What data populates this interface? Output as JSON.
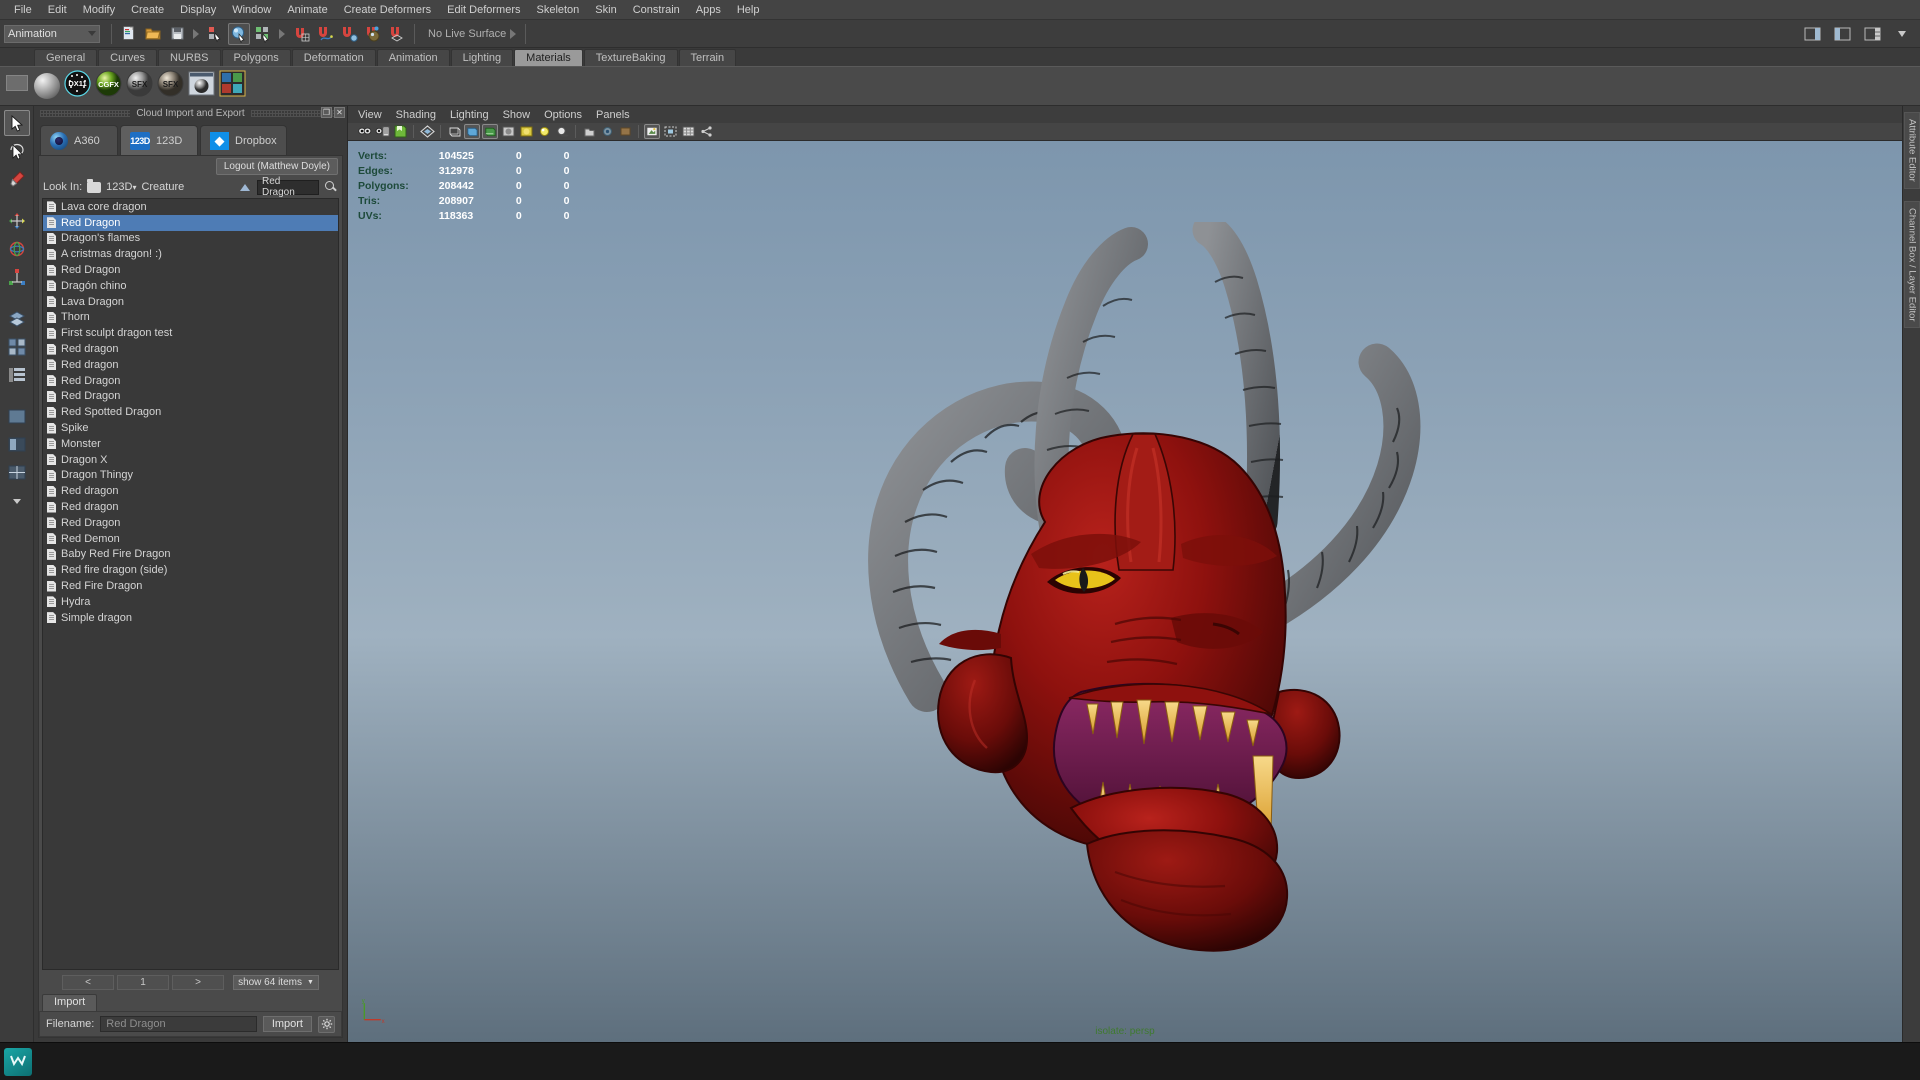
{
  "menubar": {
    "items": [
      "File",
      "Edit",
      "Modify",
      "Create",
      "Display",
      "Window",
      "Animate",
      "Create Deformers",
      "Edit Deformers",
      "Skeleton",
      "Skin",
      "Constrain",
      "Apps",
      "Help"
    ]
  },
  "toolbar": {
    "menuset_value": "Animation",
    "live_surface_label": "No Live Surface",
    "icons": [
      "new-scene-icon",
      "open-scene-icon",
      "save-scene-icon",
      "undo-icon",
      "redo-icon",
      "select-by-object-icon",
      "select-by-component-icon",
      "snap-to-grid-icon",
      "snap-to-curve-icon",
      "snap-to-point-icon",
      "snap-to-projected-center-icon",
      "snap-to-view-plane-icon"
    ]
  },
  "shelf": {
    "tabs": [
      "General",
      "Curves",
      "NURBS",
      "Polygons",
      "Deformation",
      "Animation",
      "Lighting",
      "Materials",
      "TextureBaking",
      "Terrain"
    ],
    "selected_tab": "Materials",
    "icons": [
      "material-sphere-icon",
      "dx11-shader-icon",
      "cgfx-shader-icon",
      "sfx-shader-icon",
      "sfx-alt-shader-icon",
      "render-preview-icon",
      "hypershade-grid-icon"
    ]
  },
  "tools": {
    "items": [
      "select-tool-icon",
      "lasso-select-icon",
      "paint-select-icon",
      "move-tool-icon",
      "rotate-tool-icon",
      "scale-tool-icon",
      "soft-mod-icon",
      "show-manipulator-icon",
      "last-tool-icon",
      "layout-single-icon",
      "layout-four-icon",
      "layout-persp-outliner-icon",
      "layout-hypershade-icon",
      "layout-dropdown-icon"
    ]
  },
  "cloud_panel": {
    "title": "Cloud Import and Export",
    "close_label": "✕",
    "restore_label": "❐",
    "tabs": [
      {
        "label": "A360",
        "icon": "a360-icon",
        "selected": false
      },
      {
        "label": "123D",
        "icon": "123d-icon",
        "selected": true
      },
      {
        "label": "Dropbox",
        "icon": "dropbox-icon",
        "selected": false
      }
    ],
    "logout_label": "Logout (Matthew Doyle)",
    "lookin_label": "Look In:",
    "breadcrumb_root": "123D",
    "breadcrumb_folder": "Creature",
    "search_value": "Red Dragon",
    "files": [
      {
        "name": "Lava core dragon",
        "selected": false
      },
      {
        "name": "Red Dragon",
        "selected": true
      },
      {
        "name": "Dragon's flames",
        "selected": false
      },
      {
        "name": "A cristmas dragon! :)",
        "selected": false
      },
      {
        "name": "Red Dragon",
        "selected": false
      },
      {
        "name": "Dragón chino",
        "selected": false
      },
      {
        "name": "Lava Dragon",
        "selected": false
      },
      {
        "name": "Thorn",
        "selected": false
      },
      {
        "name": "First sculpt dragon test",
        "selected": false
      },
      {
        "name": "Red dragon",
        "selected": false
      },
      {
        "name": "Red dragon",
        "selected": false
      },
      {
        "name": "Red Dragon",
        "selected": false
      },
      {
        "name": "Red Dragon",
        "selected": false
      },
      {
        "name": "Red Spotted Dragon",
        "selected": false
      },
      {
        "name": "Spike",
        "selected": false
      },
      {
        "name": "Monster",
        "selected": false
      },
      {
        "name": "Dragon X",
        "selected": false
      },
      {
        "name": "Dragon Thingy",
        "selected": false
      },
      {
        "name": "Red dragon",
        "selected": false
      },
      {
        "name": "Red dragon",
        "selected": false
      },
      {
        "name": "Red Dragon",
        "selected": false
      },
      {
        "name": "Red Demon",
        "selected": false
      },
      {
        "name": "Baby Red Fire Dragon",
        "selected": false
      },
      {
        "name": "Red fire dragon (side)",
        "selected": false
      },
      {
        "name": "Red Fire Dragon",
        "selected": false
      },
      {
        "name": "Hydra",
        "selected": false
      },
      {
        "name": "Simple dragon",
        "selected": false
      }
    ],
    "pager": {
      "prev": "<",
      "page": "1",
      "next": ">",
      "show": "show 64 items"
    },
    "import_tab_label": "Import",
    "filename_label": "Filename:",
    "filename_value": "Red Dragon",
    "import_button": "Import",
    "settings_icon": "gear-icon"
  },
  "viewport": {
    "menus": [
      "View",
      "Shading",
      "Lighting",
      "Show",
      "Options",
      "Panels"
    ],
    "stats": {
      "headers": [
        "",
        ""
      ],
      "rows": [
        {
          "label": "Verts:",
          "total": "104525",
          "c2": "0",
          "c3": "0"
        },
        {
          "label": "Edges:",
          "total": "312978",
          "c2": "0",
          "c3": "0"
        },
        {
          "label": "Polygons:",
          "total": "208442",
          "c2": "0",
          "c3": "0"
        },
        {
          "label": "Tris:",
          "total": "208907",
          "c2": "0",
          "c3": "0"
        },
        {
          "label": "UVs:",
          "total": "118363",
          "c2": "0",
          "c3": "0"
        }
      ]
    },
    "label": "isolate: persp",
    "axis": {
      "x": "x",
      "y": "y"
    }
  },
  "right_dock": {
    "tabs": [
      "Attribute Editor",
      "Channel Box / Layer Editor"
    ]
  },
  "colors": {
    "accent_blue": "#4e7cb5",
    "shelf_selected": "#9a9a9a",
    "dropbox_blue": "#0f8fe8",
    "stat_label_green": "#1d4a3a",
    "viewport_label_green": "#3f7a2f"
  }
}
